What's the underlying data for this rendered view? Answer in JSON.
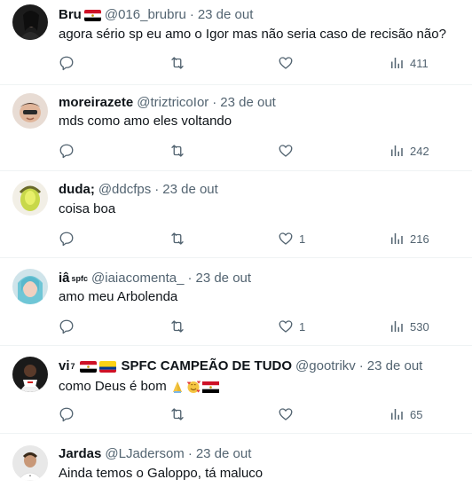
{
  "colors": {
    "text_primary": "#0f1419",
    "text_secondary": "#536471",
    "divider": "#eff3f4"
  },
  "icons": {
    "reply": "reply-icon",
    "retweet": "retweet-icon",
    "like": "heart-icon",
    "views": "analytics-icon"
  },
  "tweets": [
    {
      "name": "Bru",
      "flags": [
        "egypt-flag"
      ],
      "handle": "@016_brubru",
      "date": "23 de out",
      "text": "agora sério sp eu amo o Igor mas não seria caso de recisão não?",
      "likes": "",
      "views": "411"
    },
    {
      "name": "moreirazete",
      "handle": "@triztricoIor",
      "date": "23 de out",
      "text": "mds como amo eles voltando",
      "likes": "",
      "views": "242"
    },
    {
      "name": "duda;",
      "handle": "@ddcfps",
      "date": "23 de out",
      "text": "coisa boa",
      "likes": "1",
      "views": "216"
    },
    {
      "name": "iâ",
      "name_sup": "spfc",
      "handle": "@iaiacomenta_",
      "date": "23 de out",
      "text": "amo meu Arbolenda",
      "likes": "1",
      "views": "530"
    },
    {
      "name": "vi",
      "name_sup": "7",
      "name_suffix": "SPFC CAMPEÃO DE TUDO",
      "flags": [
        "egypt-flag",
        "colombia-flag"
      ],
      "handle": "@gootrikv",
      "date": "23 de out",
      "text": "como Deus é bom",
      "text_emoji": [
        "praying-hands-emoji",
        "smiling-face-with-hearts-emoji",
        "egypt-flag"
      ],
      "likes": "",
      "views": "65"
    },
    {
      "name": "Jardas",
      "handle": "@LJadersom",
      "date": "23 de out",
      "text": "Ainda temos o Galoppo, tá maluco"
    }
  ]
}
